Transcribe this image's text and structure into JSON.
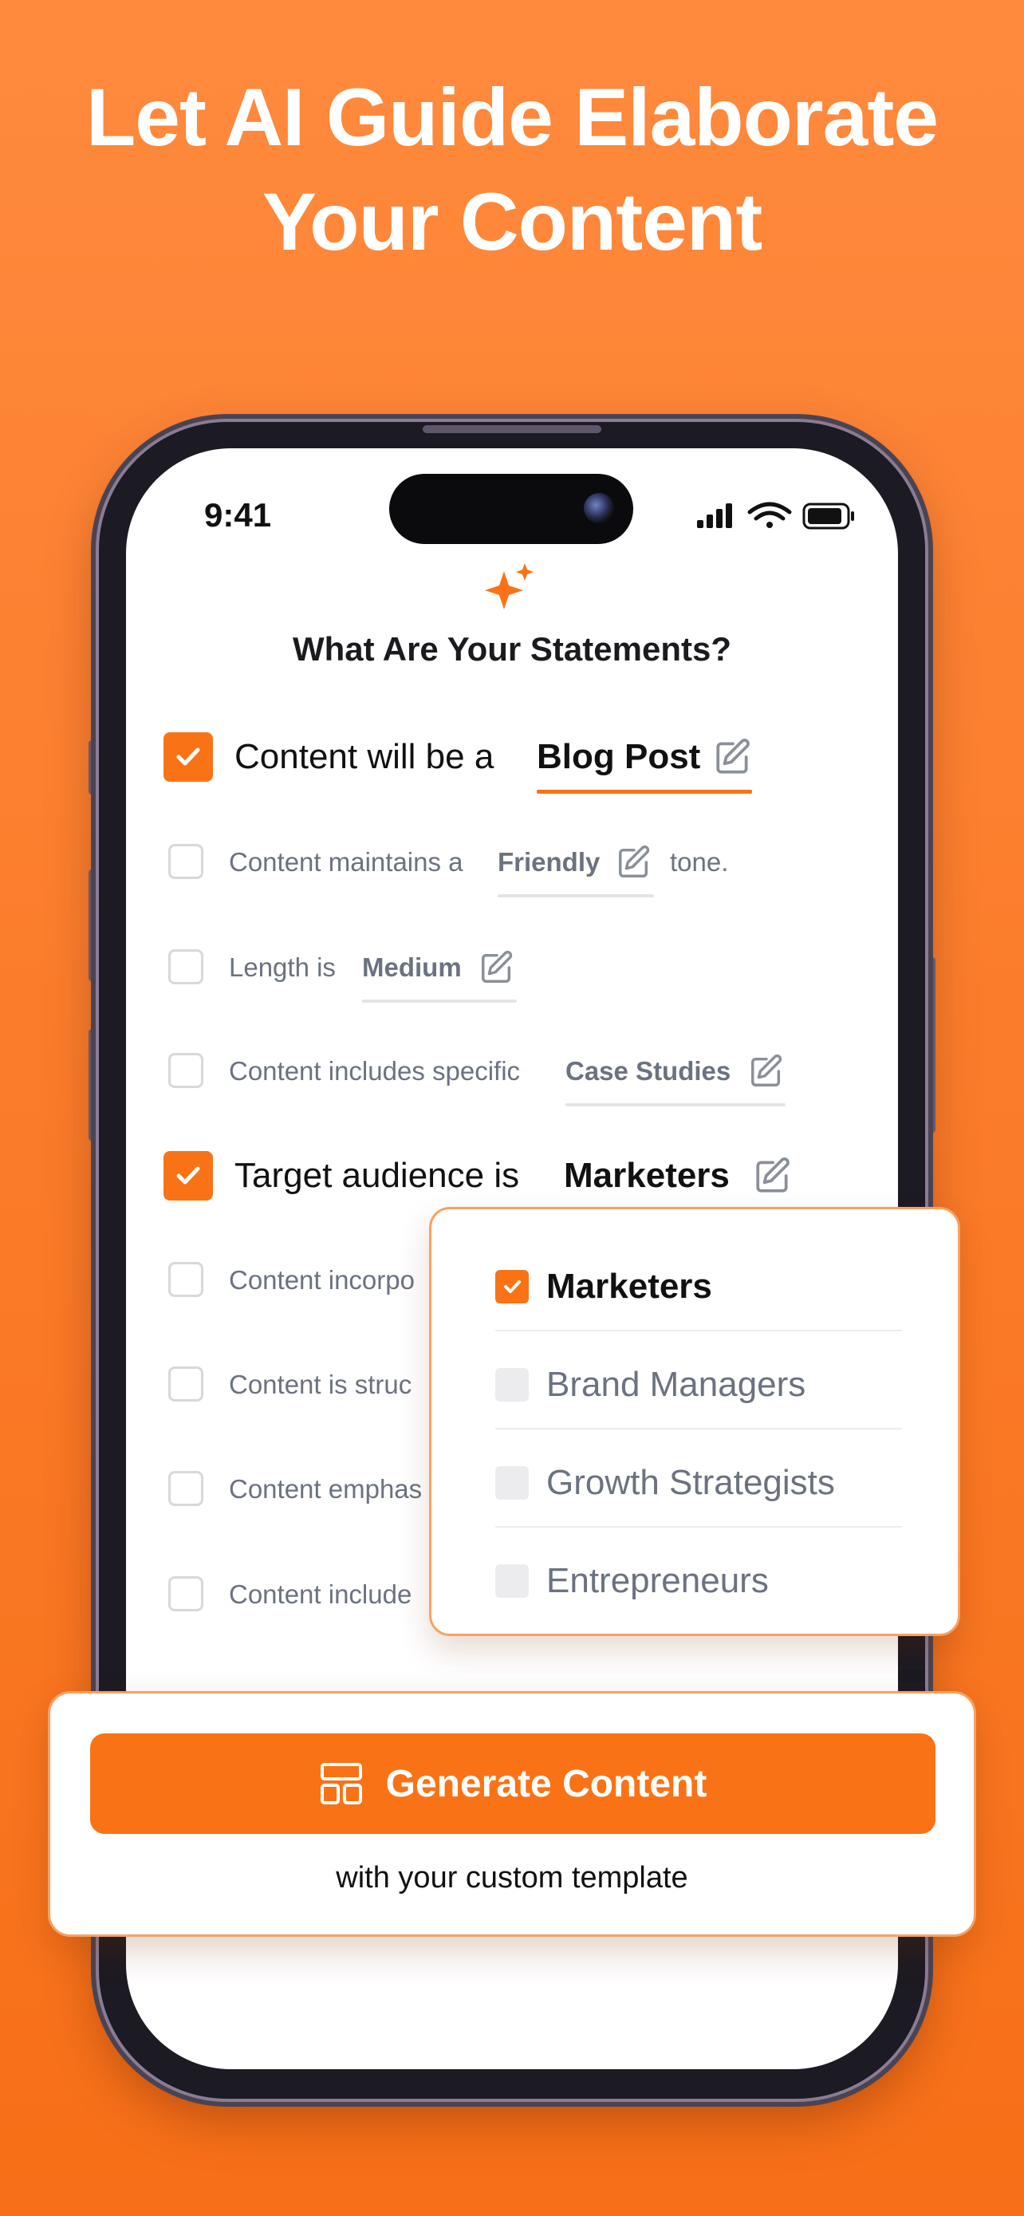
{
  "headline": {
    "line1": "Let AI Guide Elaborate",
    "line2": "Your Content"
  },
  "status_bar": {
    "time": "9:41",
    "icons": [
      "signal-icon",
      "wifi-icon",
      "battery-icon"
    ]
  },
  "screen": {
    "title": "What Are Your Statements?",
    "statements": [
      {
        "checked": true,
        "prefix": "Content will be a",
        "value": "Blog Post",
        "suffix": ""
      },
      {
        "checked": false,
        "prefix": "Content maintains a",
        "value": "Friendly",
        "suffix": "tone."
      },
      {
        "checked": false,
        "prefix": "Length is",
        "value": "Medium",
        "suffix": ""
      },
      {
        "checked": false,
        "prefix": "Content includes specific",
        "value": "Case Studies",
        "suffix": ""
      },
      {
        "checked": true,
        "prefix": "Target audience is",
        "value": "Marketers",
        "suffix": ""
      },
      {
        "checked": false,
        "prefix": "Content incorpo",
        "value": "",
        "suffix": ""
      },
      {
        "checked": false,
        "prefix": "Content is struc",
        "value": "",
        "suffix": ""
      },
      {
        "checked": false,
        "prefix": "Content emphas",
        "value": "",
        "suffix": ""
      },
      {
        "checked": false,
        "prefix": "Content include",
        "value": "",
        "suffix": ""
      }
    ]
  },
  "audience_dropdown": {
    "options": [
      {
        "label": "Marketers",
        "selected": true
      },
      {
        "label": "Brand Managers",
        "selected": false
      },
      {
        "label": "Growth Strategists",
        "selected": false
      },
      {
        "label": "Entrepreneurs",
        "selected": false
      }
    ]
  },
  "generate": {
    "button_label": "Generate Content",
    "subtitle": "with your custom template"
  },
  "colors": {
    "accent": "#f97316",
    "background": "#fb7d2c",
    "muted_text": "#6b7280",
    "text": "#111111"
  }
}
